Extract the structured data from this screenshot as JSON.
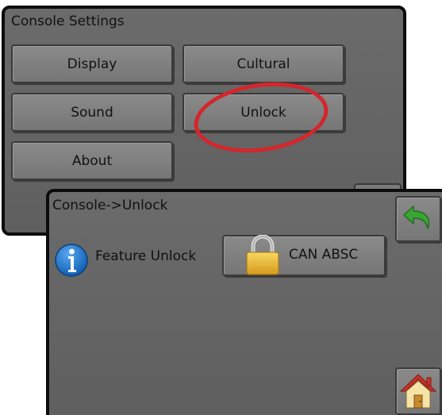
{
  "settings": {
    "title": "Console Settings",
    "buttons": {
      "display": "Display",
      "cultural": "Cultural",
      "sound": "Sound",
      "unlock": "Unlock",
      "about": "About"
    }
  },
  "unlock_screen": {
    "title": "Console->Unlock",
    "feature_label": "Feature Unlock",
    "feature_button": "CAN ABSC"
  },
  "icons": {
    "info": "info-icon",
    "lock": "padlock-icon",
    "back": "back-arrow-icon",
    "home": "home-icon"
  },
  "colors": {
    "panel": "#666666",
    "button": "#808080",
    "highlight": "#d4262c",
    "info_blue": "#1a72c9",
    "back_green": "#3aa535",
    "lock_gold": "#e9b52d"
  }
}
